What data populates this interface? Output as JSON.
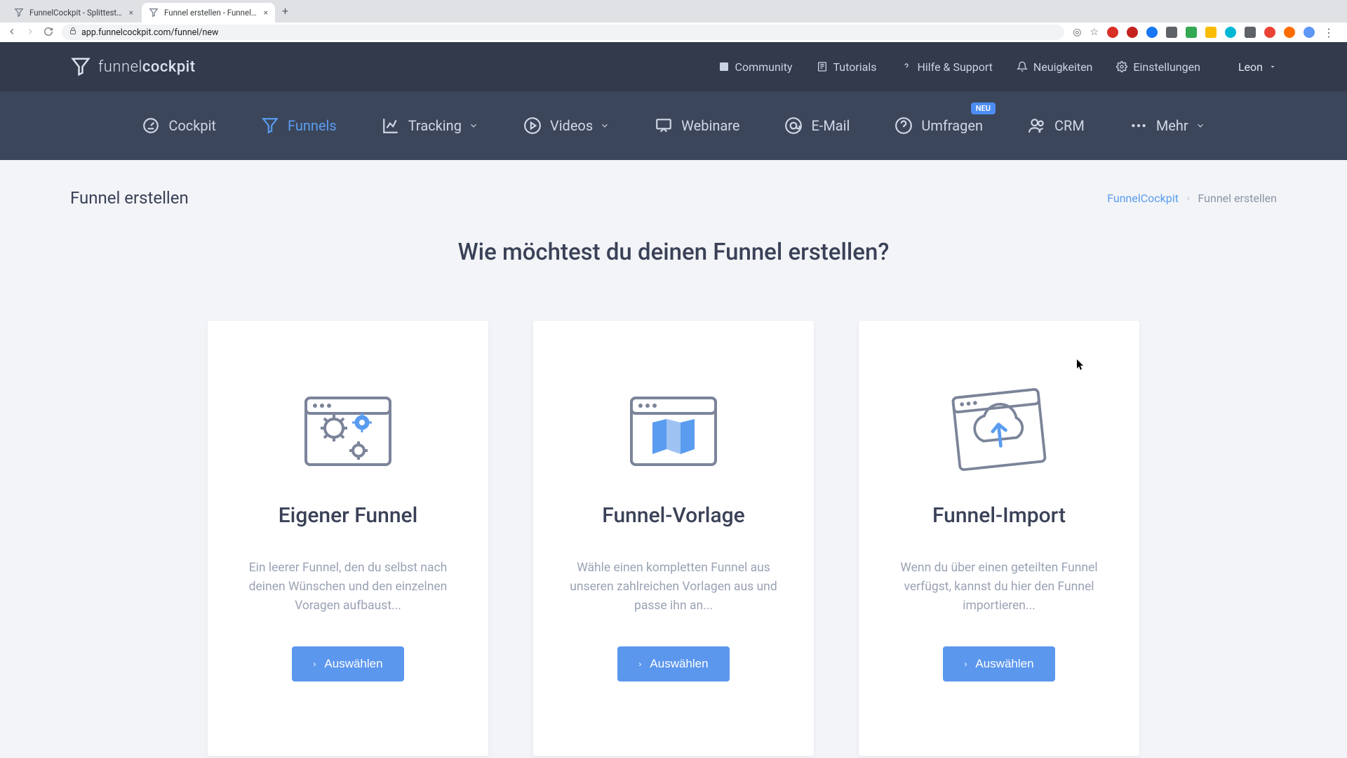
{
  "browser": {
    "tabs": [
      {
        "title": "FunnelCockpit - Splittests, Ma…",
        "active": false
      },
      {
        "title": "Funnel erstellen - FunnelCock…",
        "active": true
      }
    ],
    "url": "app.funnelcockpit.com/funnel/new"
  },
  "brand": {
    "part1": "funnel",
    "part2": "cockpit"
  },
  "top_links": {
    "community": "Community",
    "tutorials": "Tutorials",
    "support": "Hilfe & Support",
    "news": "Neuigkeiten",
    "settings": "Einstellungen"
  },
  "user": {
    "name": "Leon"
  },
  "nav": {
    "cockpit": "Cockpit",
    "funnels": "Funnels",
    "tracking": "Tracking",
    "videos": "Videos",
    "webinare": "Webinare",
    "email": "E-Mail",
    "umfragen": "Umfragen",
    "umfragen_badge": "NEU",
    "crm": "CRM",
    "mehr": "Mehr"
  },
  "page": {
    "title": "Funnel erstellen",
    "breadcrumb_root": "FunnelCockpit",
    "breadcrumb_current": "Funnel erstellen",
    "headline": "Wie möchtest du deinen Funnel erstellen?"
  },
  "cards": {
    "own": {
      "title": "Eigener Funnel",
      "desc": "Ein leerer Funnel, den du selbst nach deinen Wünschen und den einzelnen Voragen aufbaust...",
      "button": "Auswählen"
    },
    "template": {
      "title": "Funnel-Vorlage",
      "desc": "Wähle einen kompletten Funnel aus unseren zahlreichen Vorlagen aus und passe ihn an...",
      "button": "Auswählen"
    },
    "import": {
      "title": "Funnel-Import",
      "desc": "Wenn du über einen geteilten Funnel verfügst, kannst du hier den Funnel importieren...",
      "button": "Auswählen"
    }
  }
}
